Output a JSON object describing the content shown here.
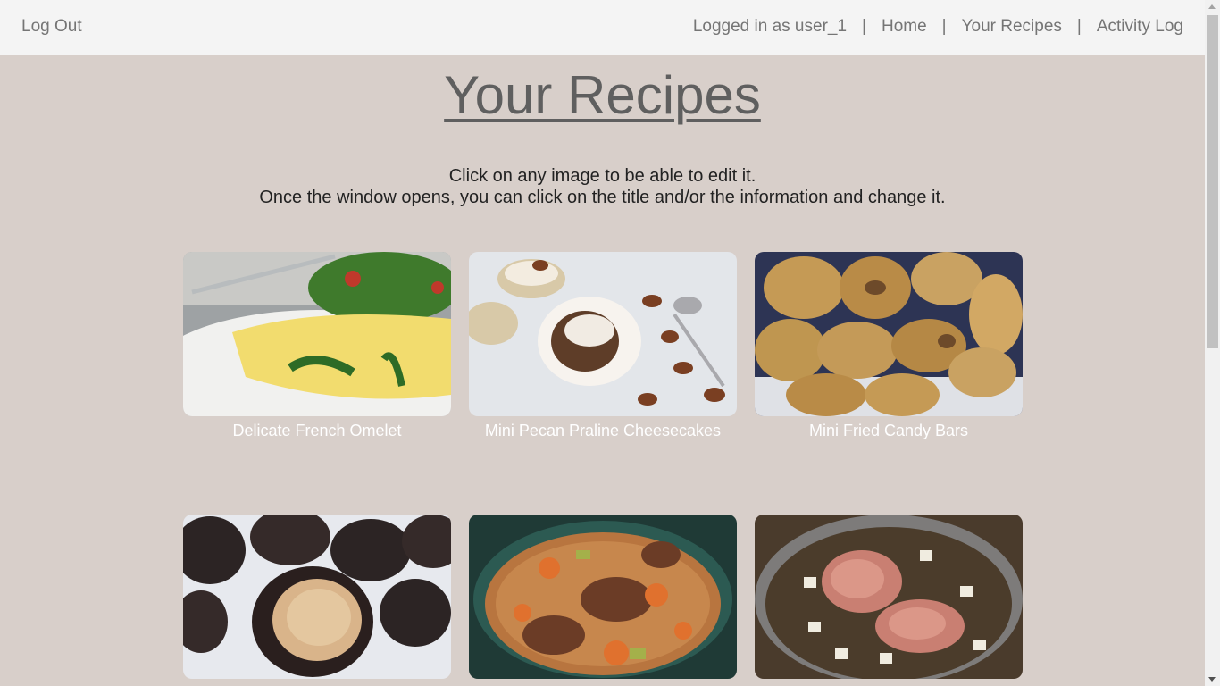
{
  "header": {
    "logout_label": "Log Out",
    "user_text": "Logged in as user_1",
    "separator": "|",
    "nav": [
      "Home",
      "Your Recipes",
      "Activity Log"
    ]
  },
  "page": {
    "title": "Your Recipes",
    "instructions_line1": "Click on any image to be able to edit it.",
    "instructions_line2": "Once the window opens, you can click on the title and/or the information and change it."
  },
  "recipes": [
    {
      "title": "Delicate French Omelet",
      "image": "omelet-photo"
    },
    {
      "title": "Mini Pecan Praline Cheesecakes",
      "image": "cheesecake-photo"
    },
    {
      "title": "Mini Fried Candy Bars",
      "image": "fried-candy-photo"
    },
    {
      "title": "",
      "image": "chocolate-truffle-photo"
    },
    {
      "title": "",
      "image": "beef-stew-photo"
    },
    {
      "title": "",
      "image": "ham-pot-photo"
    }
  ],
  "colors": {
    "background": "#d8cfca",
    "header_bg": "#f4f4f4",
    "header_text": "#757575",
    "title": "#5f5f5f",
    "caption": "#ffffff"
  }
}
